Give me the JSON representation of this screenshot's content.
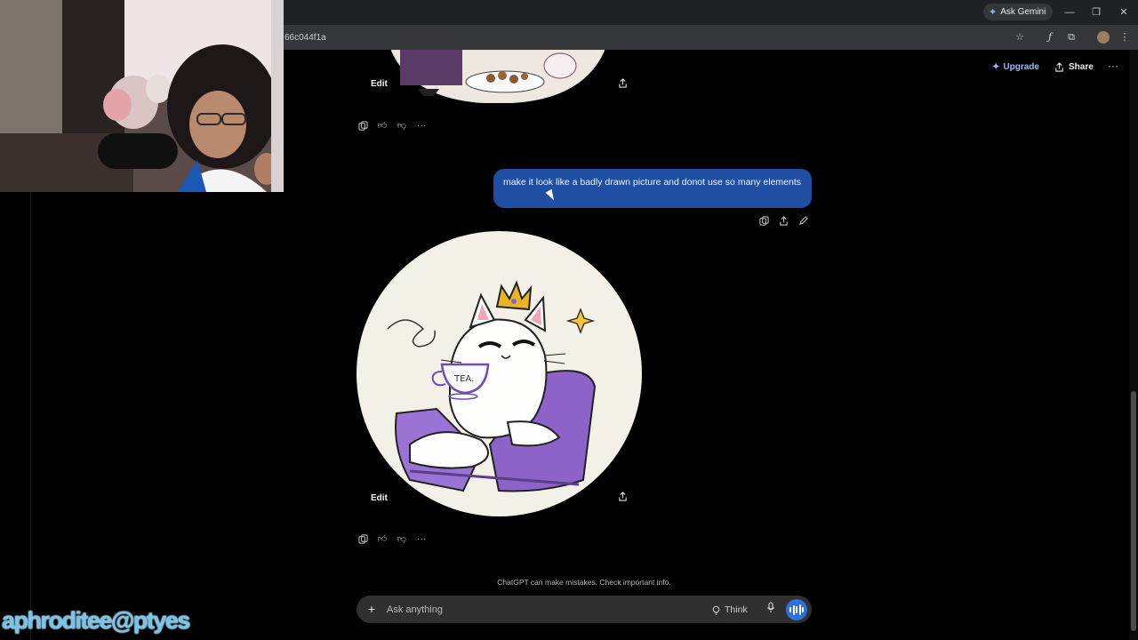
{
  "browser": {
    "ask_gemini_label": "Ask Gemini",
    "url_fragment": "66c044f1a"
  },
  "header": {
    "upgrade_label": "Upgrade",
    "share_label": "Share"
  },
  "previous_image": {
    "edit_label": "Edit"
  },
  "user_message": {
    "text": "make it look like a badly drawn picture and donot use so many elements"
  },
  "generated_image": {
    "edit_label": "Edit",
    "cup_text": "TEA."
  },
  "footer": {
    "disclaimer": "ChatGPT can make mistakes. Check important info.",
    "composer_placeholder": "Ask anything",
    "think_label": "Think"
  },
  "overlay": {
    "watermark": "aphroditee@ptyes"
  },
  "colors": {
    "bubble": "#1f4ea3",
    "upgrade": "#9bb7ff",
    "voice_button": "#2f6fd9",
    "chair": "#8d62c9",
    "crown": "#e9b526"
  }
}
